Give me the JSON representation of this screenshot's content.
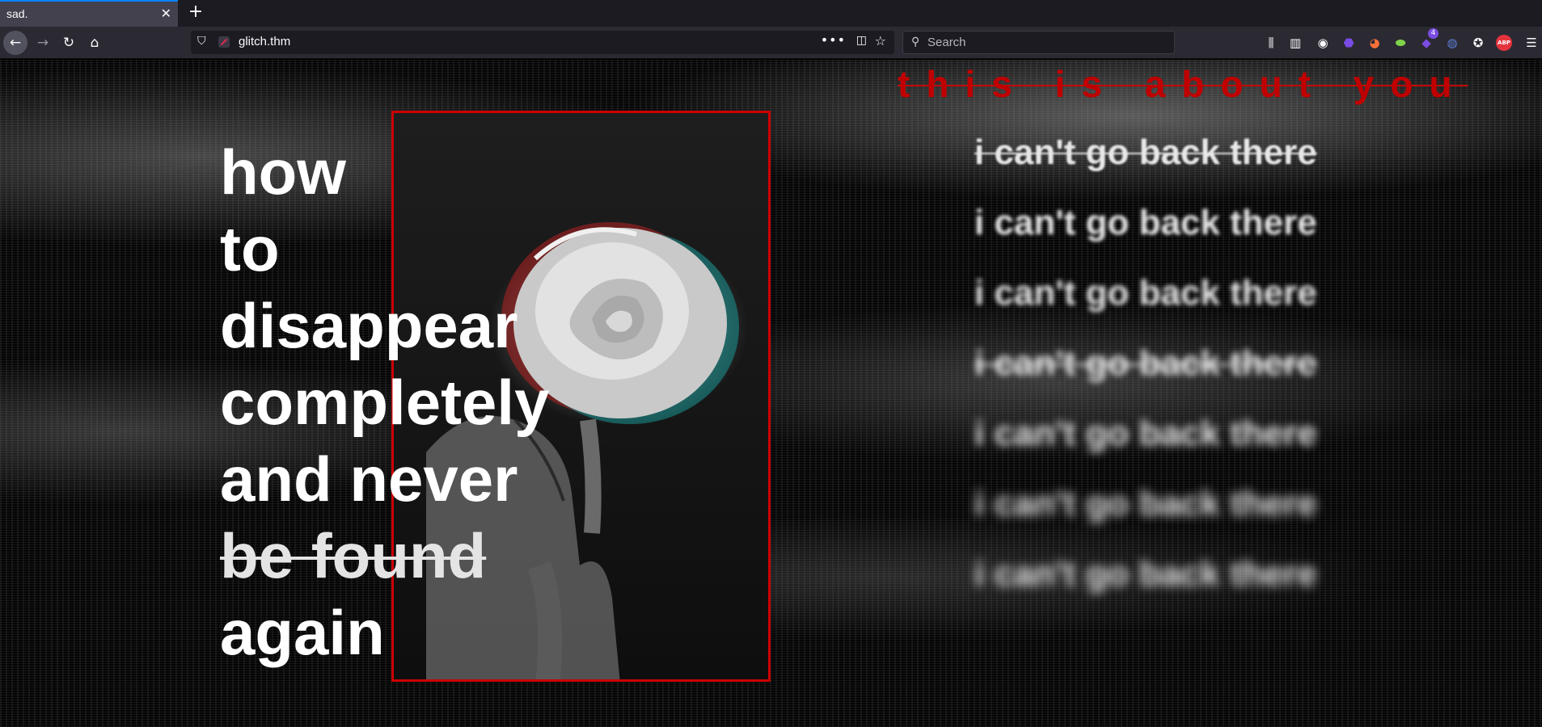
{
  "tab": {
    "title": "sad.",
    "close": "✕",
    "new_tab": "+"
  },
  "nav": {
    "back": "←",
    "forward": "→",
    "reload": "↻",
    "home": "⌂",
    "url": "glitch.thm",
    "more_glyph": "•••",
    "pocket_glyph": "◫",
    "star_glyph": "☆"
  },
  "search": {
    "placeholder": "Search",
    "icon_glyph": "⚲"
  },
  "toolbar": {
    "library_icon": "library-icon",
    "sidebar_icon": "sidebar-icon",
    "account_icon": "account-icon",
    "abp_label": "ABP",
    "badge_count": "4",
    "menu_glyph": "☰"
  },
  "headline": {
    "lines": [
      "how",
      "to",
      "disappear",
      "completely",
      "and never"
    ],
    "struck": "be found",
    "last": "again"
  },
  "tagline": "this is about you",
  "repeat_line": "i can't go back there",
  "colors": {
    "accent_red": "#cc0000",
    "tab_highlight": "#0a84ff",
    "abp_red": "#e5333d"
  }
}
